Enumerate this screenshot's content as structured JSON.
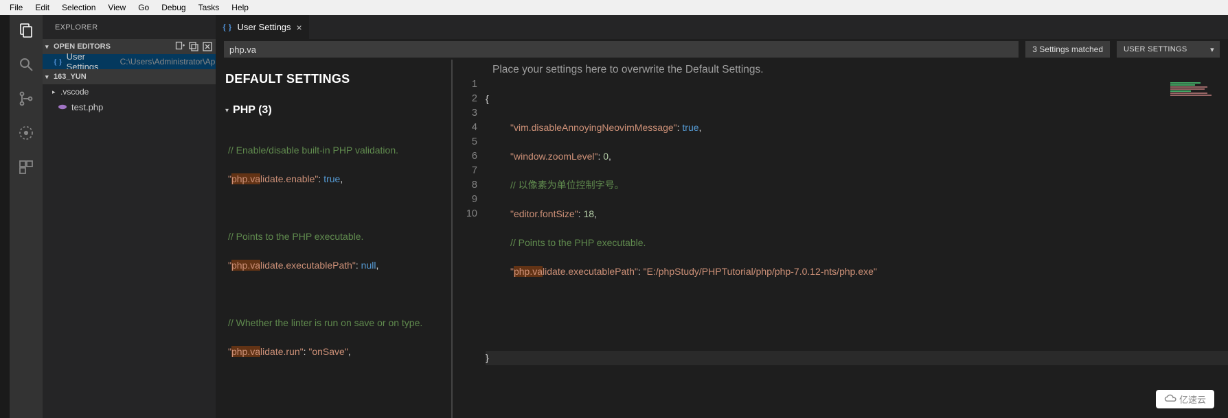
{
  "menu": [
    "File",
    "Edit",
    "Selection",
    "View",
    "Go",
    "Debug",
    "Tasks",
    "Help"
  ],
  "sidebar": {
    "title": "EXPLORER",
    "openEditors": "OPEN EDITORS",
    "openItem": {
      "icon": "{ }",
      "label": "User Settings",
      "path": "C:\\Users\\Administrator\\App..."
    },
    "project": "163_YUN",
    "folder1": ".vscode",
    "file1": "test.php"
  },
  "tab": {
    "icon": "{ }",
    "label": "User Settings"
  },
  "search": {
    "value": "php.va",
    "matches": "3 Settings matched",
    "scope": "USER SETTINGS"
  },
  "defaults": {
    "title": "DEFAULT SETTINGS",
    "group": "PHP (3)",
    "c1": "// Enable/disable built-in PHP validation.",
    "k1a": "\"",
    "k1h": "php.va",
    "k1b": "lidate.enable\"",
    "k1c": ": ",
    "k1d": "true",
    "k1e": ",",
    "c2": "// Points to the PHP executable.",
    "k2a": "\"",
    "k2h": "php.va",
    "k2b": "lidate.executablePath\"",
    "k2c": ": ",
    "k2d": "null",
    "k2e": ",",
    "c3": "// Whether the linter is run on save or on type.",
    "k3a": "\"",
    "k3h": "php.va",
    "k3b": "lidate.run\"",
    "k3c": ": ",
    "k3d": "\"onSave\"",
    "k3e": ","
  },
  "user": {
    "hint": "Place your settings here to overwrite the Default Settings.",
    "lines": {
      "1": "{",
      "2p": "\"vim.disableAnnoyingNeovimMessage\"",
      "2c": ": ",
      "2v": "true",
      "2e": ",",
      "3p": "\"window.zoomLevel\"",
      "3c": ": ",
      "3v": "0",
      "3e": ",",
      "4": "// 以像素为单位控制字号。",
      "5p": "\"editor.fontSize\"",
      "5c": ": ",
      "5v": "18",
      "5e": ",",
      "6": "// Points to the PHP executable.",
      "7a": "\"",
      "7h": "php.va",
      "7b": "lidate.executablePath\"",
      "7c": ": ",
      "7v": "\"E:/phpStudy/PHPTutorial/php/php-7.0.12-nts/php.exe\"",
      "10": "}"
    }
  },
  "watermark": "亿速云"
}
